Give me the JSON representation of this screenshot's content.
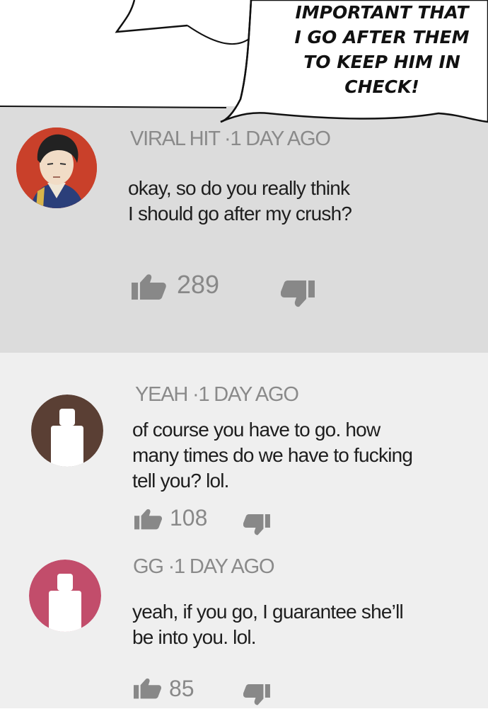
{
  "speech_bubble": {
    "lines": [
      "IMPORTANT THAT",
      "I GO AFTER THEM",
      "TO KEEP HIM IN",
      "CHECK!"
    ]
  },
  "comments": [
    {
      "author": "VIRAL HIT",
      "time": "1 DAY AGO",
      "lines": [
        "okay, so do you really think",
        "I should go  after my crush?"
      ],
      "likes": "289",
      "avatar": "character-avatar"
    },
    {
      "author": "YEAH",
      "time": "1 DAY AGO",
      "lines": [
        "of course you have to go. how",
        "many times do we have to fucking",
        "tell you? lol."
      ],
      "likes": "108",
      "avatar": "default-avatar",
      "avatar_color": "#5a3f34"
    },
    {
      "author": "GG",
      "time": "1 DAY AGO",
      "lines": [
        "yeah, if you go,  I guarantee she’ll",
        "be into you. lol."
      ],
      "likes": "85",
      "avatar": "default-avatar",
      "avatar_color": "#c24d6b"
    }
  ],
  "icons": {
    "like": "thumbs-up-icon",
    "dislike": "thumbs-down-icon"
  },
  "colors": {
    "highlight_bg": "#dcdcdc",
    "comment_bg": "#efefef",
    "meta_text": "#8a8a8a"
  }
}
